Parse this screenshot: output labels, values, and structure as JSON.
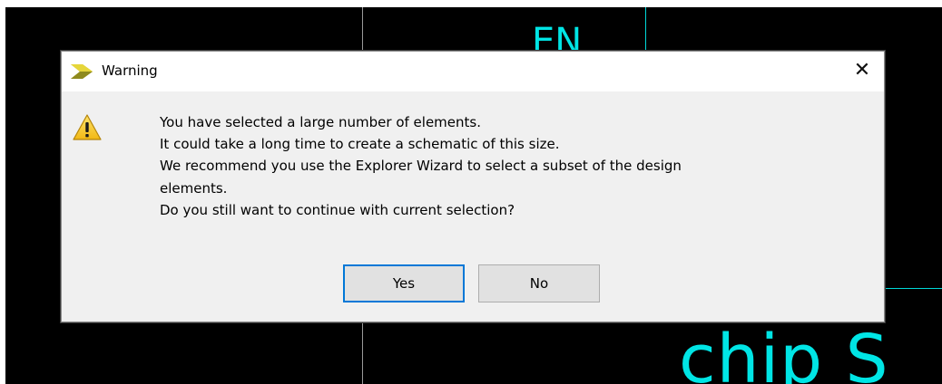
{
  "background": {
    "labels": {
      "en": "EN",
      "chip": "chip S"
    },
    "colors": {
      "canvas": "#000000",
      "wire": "#00d8d8",
      "text": "#00e5e5"
    }
  },
  "dialog": {
    "title": "Warning",
    "title_icon": "vivado-chevron-icon",
    "close_icon": "close-icon",
    "close_glyph": "✕",
    "message_icon": "warning-icon",
    "message_lines": [
      "You have selected a large number of elements.",
      "It could take a long time to create a schematic of this size.",
      "We recommend you use the Explorer Wizard to select a subset of the design",
      "elements.",
      "Do you still want to continue with current selection?"
    ],
    "buttons": {
      "yes": "Yes",
      "no": "No"
    },
    "focused_button": "yes",
    "accent_color": "#0078d7"
  }
}
